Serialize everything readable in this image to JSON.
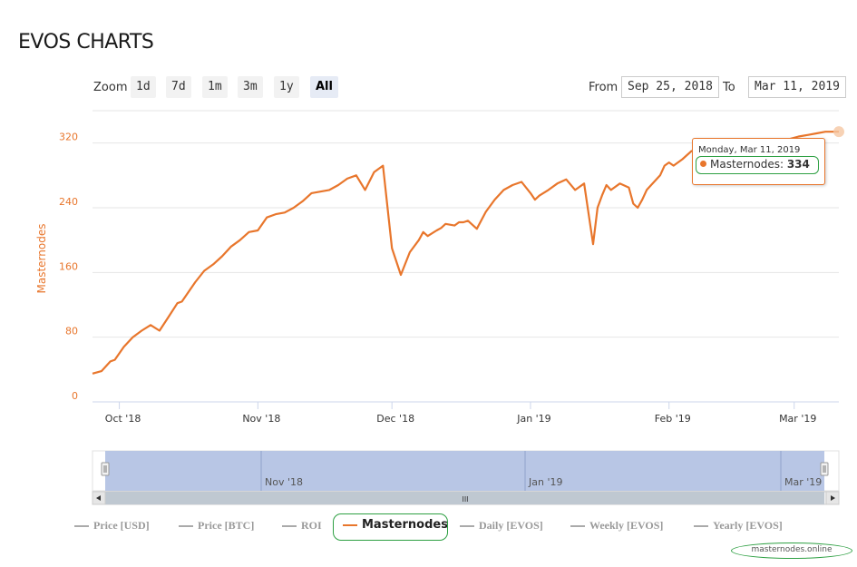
{
  "page": {
    "title": "EVOS CHARTS"
  },
  "toolbar": {
    "zoom_label": "Zoom",
    "zoom_buttons": [
      "1d",
      "7d",
      "1m",
      "3m",
      "1y",
      "All"
    ],
    "active_zoom": "All",
    "from_label": "From",
    "from_value": "Sep 25, 2018",
    "to_label": "To",
    "to_value": "Mar 11, 2019"
  },
  "tooltip": {
    "date": "Monday, Mar 11, 2019",
    "series": "Masternodes",
    "value": "334"
  },
  "navigator": {
    "labels": [
      "Nov '18",
      "Jan '19",
      "Mar '19"
    ],
    "scrollbar_grip": "III"
  },
  "legend": {
    "items": [
      "Price [USD]",
      "Price [BTC]",
      "ROI",
      "Masternodes",
      "Daily [EVOS]",
      "Weekly [EVOS]",
      "Yearly [EVOS]"
    ],
    "active": "Masternodes"
  },
  "credit": "masternodes.online",
  "colors": {
    "series": "#e8762c",
    "highlight": "#2ea043",
    "navigator_fill": "#b4c3e4"
  },
  "chart_data": {
    "type": "line",
    "ylabel": "Masternodes",
    "ylim": [
      0,
      360
    ],
    "yticks": [
      0,
      80,
      160,
      240,
      320
    ],
    "x_ticks": [
      "Oct '18",
      "Nov '18",
      "Dec '18",
      "Jan '19",
      "Feb '19",
      "Mar '19"
    ],
    "x_range": [
      "2018-09-25",
      "2019-03-11"
    ],
    "grid": true,
    "series": [
      {
        "name": "Masternodes",
        "x": [
          "2018-09-25",
          "2018-09-27",
          "2018-09-29",
          "2018-09-30",
          "2018-10-02",
          "2018-10-04",
          "2018-10-06",
          "2018-10-08",
          "2018-10-10",
          "2018-10-12",
          "2018-10-14",
          "2018-10-15",
          "2018-10-16",
          "2018-10-18",
          "2018-10-20",
          "2018-10-22",
          "2018-10-24",
          "2018-10-26",
          "2018-10-28",
          "2018-10-30",
          "2018-11-01",
          "2018-11-03",
          "2018-11-05",
          "2018-11-07",
          "2018-11-09",
          "2018-11-11",
          "2018-11-13",
          "2018-11-15",
          "2018-11-17",
          "2018-11-19",
          "2018-11-21",
          "2018-11-23",
          "2018-11-25",
          "2018-11-27",
          "2018-11-29",
          "2018-12-01",
          "2018-12-03",
          "2018-12-05",
          "2018-12-07",
          "2018-12-08",
          "2018-12-09",
          "2018-12-11",
          "2018-12-12",
          "2018-12-13",
          "2018-12-15",
          "2018-12-16",
          "2018-12-17",
          "2018-12-18",
          "2018-12-20",
          "2018-12-22",
          "2018-12-24",
          "2018-12-26",
          "2018-12-28",
          "2018-12-30",
          "2019-01-01",
          "2019-01-02",
          "2019-01-03",
          "2019-01-05",
          "2019-01-07",
          "2019-01-09",
          "2019-01-11",
          "2019-01-13",
          "2019-01-15",
          "2019-01-16",
          "2019-01-17",
          "2019-01-18",
          "2019-01-19",
          "2019-01-21",
          "2019-01-23",
          "2019-01-24",
          "2019-01-25",
          "2019-01-26",
          "2019-01-27",
          "2019-01-28",
          "2019-01-30",
          "2019-01-31",
          "2019-02-01",
          "2019-02-02",
          "2019-02-04",
          "2019-02-06",
          "2019-02-08",
          "2019-02-10",
          "2019-02-12",
          "2019-02-14",
          "2019-02-16",
          "2019-02-18",
          "2019-02-20",
          "2019-02-22",
          "2019-02-24",
          "2019-02-26",
          "2019-02-28",
          "2019-03-02",
          "2019-03-04",
          "2019-03-06",
          "2019-03-08",
          "2019-03-11"
        ],
        "values": [
          35,
          38,
          50,
          52,
          68,
          80,
          88,
          95,
          88,
          105,
          122,
          124,
          132,
          148,
          162,
          170,
          180,
          192,
          200,
          210,
          212,
          228,
          232,
          234,
          240,
          248,
          258,
          260,
          262,
          268,
          276,
          280,
          262,
          284,
          292,
          190,
          157,
          185,
          200,
          210,
          205,
          212,
          215,
          220,
          218,
          222,
          222,
          224,
          214,
          235,
          250,
          262,
          268,
          272,
          258,
          250,
          255,
          262,
          270,
          275,
          262,
          270,
          195,
          240,
          255,
          268,
          262,
          270,
          265,
          245,
          240,
          250,
          262,
          268,
          280,
          292,
          296,
          292,
          300,
          310,
          312,
          318,
          305,
          318,
          322,
          308,
          316,
          322,
          318,
          320,
          325,
          328,
          330,
          332,
          334,
          334
        ]
      }
    ]
  }
}
